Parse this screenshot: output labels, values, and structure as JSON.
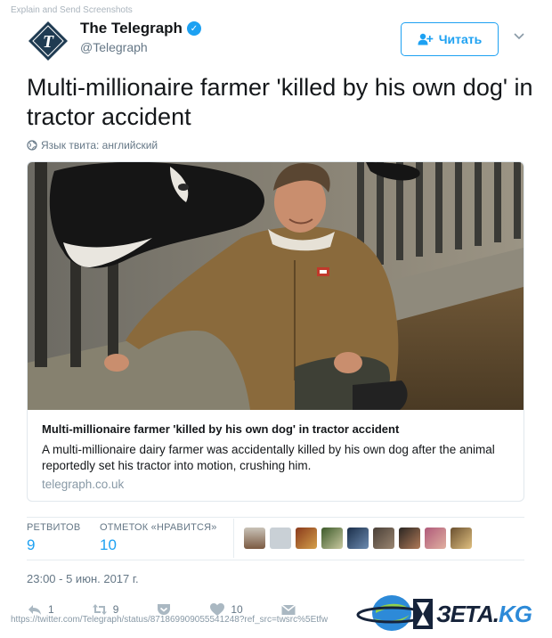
{
  "watermark": "Explain and Send Screenshots",
  "author": {
    "name": "The Telegraph",
    "handle": "@Telegraph",
    "verified": true
  },
  "follow_button": {
    "label": "Читать",
    "icon": "add-user-icon"
  },
  "tweet": {
    "text": "Multi-millionaire farmer 'killed by his own dog' in tractor accident",
    "language_note": "Язык твита: английский"
  },
  "card": {
    "image": "farmer-with-cows-photo",
    "title": "Multi-millionaire farmer 'killed by his own dog' in tractor accident",
    "description": "A multi-millionaire dairy farmer was accidentally killed by his own dog after the animal reportedly set his tractor into motion, crushing him.",
    "domain": "telegraph.co.uk"
  },
  "stats": {
    "retweets_label": "РЕТВИТОВ",
    "retweets_value": "9",
    "likes_label": "ОТМЕТОК «НРАВИТСЯ»",
    "likes_value": "10"
  },
  "timestamp": "23:00 - 5 июн. 2017 г.",
  "actions": {
    "reply_count": "1",
    "retweet_count": "9",
    "like_count": "10"
  },
  "footer": {
    "url": "https://twitter.com/Telegraph/status/871869909055541248?ref_src=twsrc%5Etfw",
    "logo_main": "ЗЕТА.",
    "logo_accent": "KG"
  },
  "colors": {
    "accent": "#1da1f2",
    "muted": "#657786",
    "logo_navy": "#16233a"
  }
}
